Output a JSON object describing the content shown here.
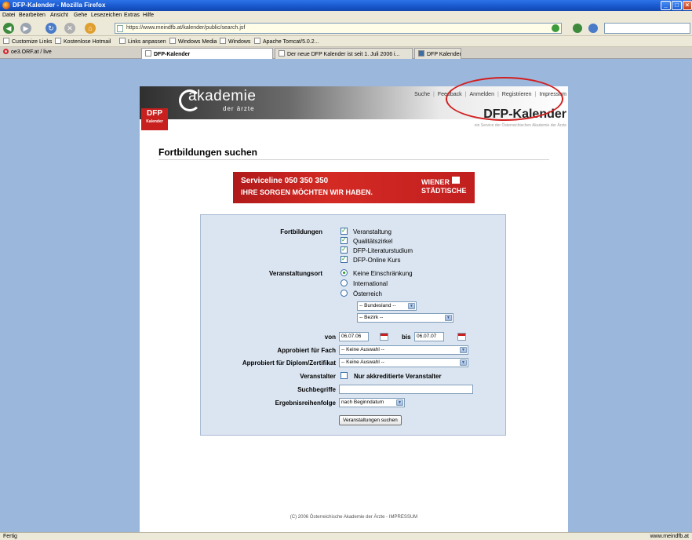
{
  "window": {
    "title": "DFP-Kalender - Mozilla Firefox"
  },
  "menu": [
    "Datei",
    "Bearbeiten",
    "Ansicht",
    "Gehe",
    "Lesezeichen",
    "Extras",
    "Hilfe"
  ],
  "address": {
    "url": "https://www.meindfb.at/kalender/public/search.jsf"
  },
  "bookmarks": [
    "Customize Links",
    "Kostenlose Hotmail",
    "Links anpassen",
    "Windows Media",
    "Windows",
    "Apache Tomcat/5.0.2..."
  ],
  "tabs": {
    "orf": "oe3.ORF.at / live",
    "items": [
      "DFP-Kalender",
      "Der neue DFP Kalender ist seit 1. Juli 2006 i...",
      "DFP Kalender"
    ]
  },
  "site": {
    "logo_text": "akademie",
    "logo_sub": "der ärzte",
    "badge_top": "DFP",
    "badge_bottom": "Kalender",
    "nav": [
      "Suche",
      "Feedback",
      "Anmelden",
      "Registrieren",
      "Impressum"
    ],
    "app_title": "DFP-Kalender",
    "service_text": "ein Service der Österreichischen Akademie der Ärzte"
  },
  "page_title": "Fortbildungen suchen",
  "banner": {
    "line1": "Serviceline 050 350 350",
    "line2": "IHRE SORGEN MÖCHTEN WIR HABEN.",
    "brand_line1": "WIENER",
    "brand_line2": "STÄDTISCHE"
  },
  "form": {
    "fortbildungen_label": "Fortbildungen",
    "fortbildungen": [
      "Veranstaltung",
      "Qualitätszirkel",
      "DFP-Literaturstudium",
      "DFP-Online Kurs"
    ],
    "ort_label": "Veranstaltungsort",
    "ort_options": [
      "Keine Einschränkung",
      "International",
      "Österreich"
    ],
    "bundesland": "-- Bundesland --",
    "bezirk": "-- Bezirk --",
    "von_label": "von",
    "von_value": "06.07.06",
    "bis_label": "bis",
    "bis_value": "06.07.07",
    "fach_label": "Approbiert für Fach",
    "fach_value": "-- Keine Auswahl --",
    "diplom_label": "Approbiert für Diplom/Zertifikat",
    "diplom_value": "-- Keine Auswahl --",
    "veranstalter_label": "Veranstalter",
    "veranstalter_option": "Nur akkreditierte Veranstalter",
    "such_label": "Suchbegriffe",
    "such_value": "",
    "reihen_label": "Ergebnisreihenfolge",
    "reihen_value": "nach Beginndatum",
    "submit": "Veranstaltungen suchen"
  },
  "footer": "(C) 2006 Österreichische Akademie der Ärzte - IMPRESSUM",
  "status": {
    "left": "Fertig",
    "right": "www.meindfb.at"
  }
}
